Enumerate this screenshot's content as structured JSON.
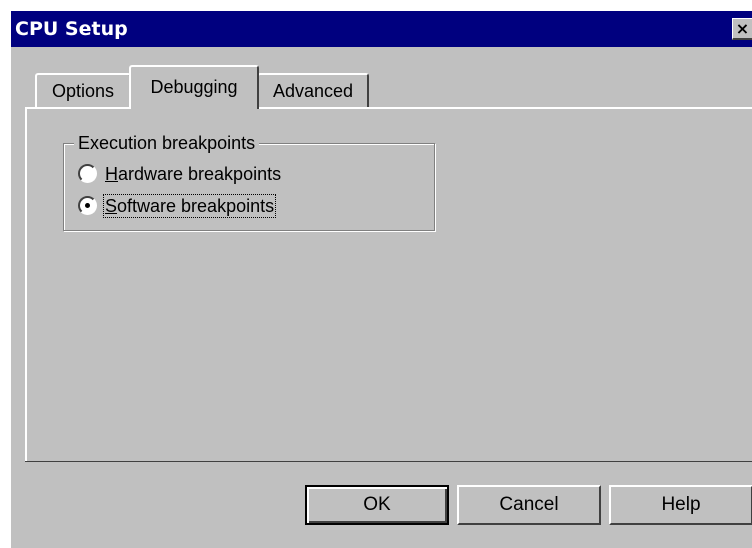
{
  "window": {
    "title": "CPU Setup",
    "close_glyph": "×"
  },
  "tabs": [
    {
      "label": "Options",
      "active": false
    },
    {
      "label": "Debugging",
      "active": true
    },
    {
      "label": "Advanced",
      "active": false
    }
  ],
  "group": {
    "legend": "Execution breakpoints",
    "options": [
      {
        "label": "Hardware breakpoints",
        "mnemonic": "H",
        "rest": "ardware breakpoints",
        "selected": false
      },
      {
        "label": "Software breakpoints",
        "mnemonic": "S",
        "rest": "oftware breakpoints",
        "selected": true
      }
    ]
  },
  "buttons": {
    "ok": "OK",
    "cancel": "Cancel",
    "help": "Help"
  },
  "colors": {
    "titlebar": "#00007f",
    "face": "#c0c0c0"
  }
}
